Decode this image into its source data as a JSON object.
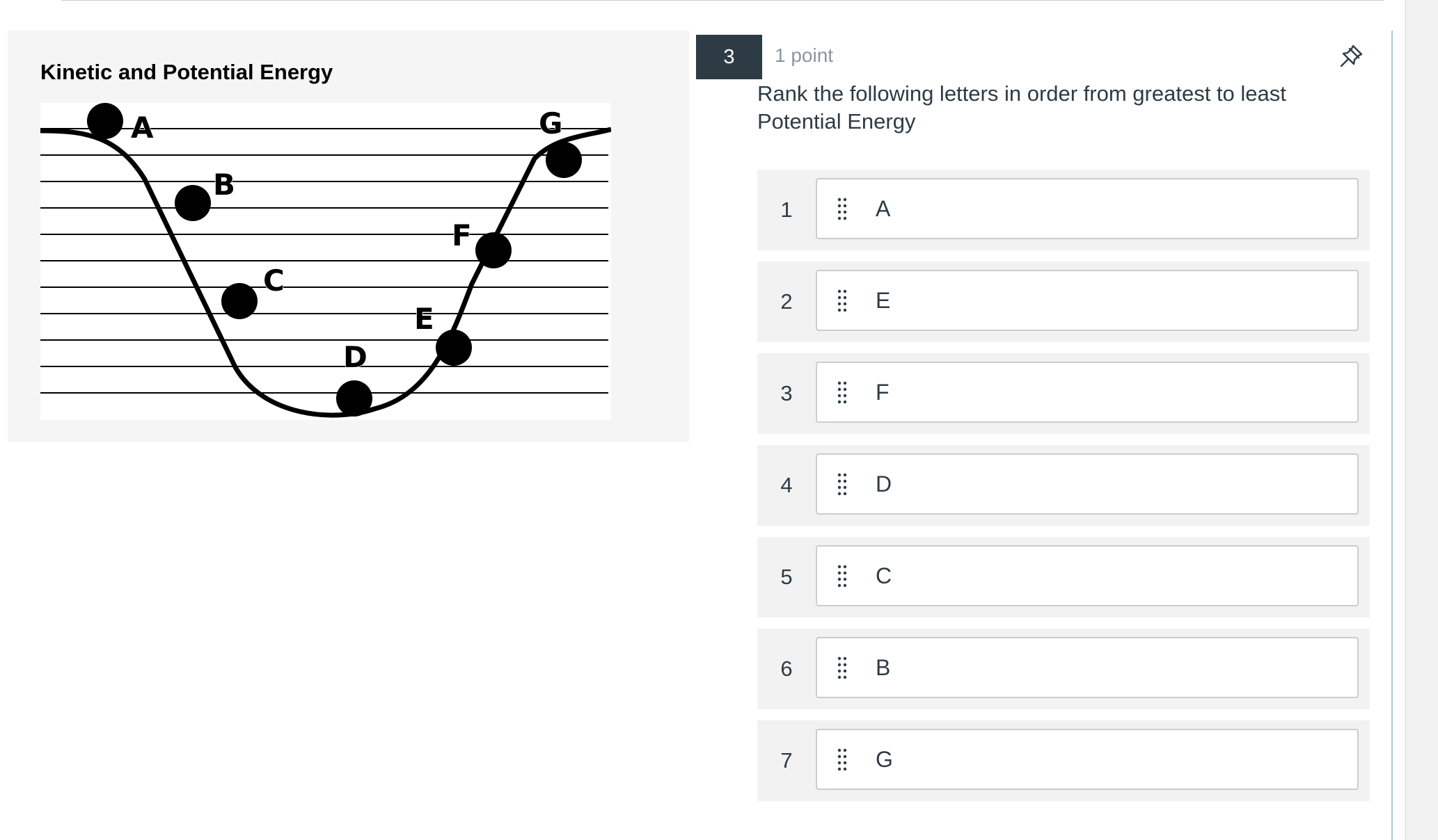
{
  "stimulus": {
    "title": "Kinetic and Potential Energy",
    "figure_labels": {
      "a": "A",
      "b": "B",
      "c": "C",
      "d": "D",
      "e": "E",
      "f": "F",
      "g": "G"
    }
  },
  "question": {
    "number": "3",
    "points": "1 point",
    "prompt": "Rank the following letters in order from greatest to least Potential Energy",
    "ranking": [
      {
        "position": "1",
        "label": "A"
      },
      {
        "position": "2",
        "label": "E"
      },
      {
        "position": "3",
        "label": "F"
      },
      {
        "position": "4",
        "label": "D"
      },
      {
        "position": "5",
        "label": "C"
      },
      {
        "position": "6",
        "label": "B"
      },
      {
        "position": "7",
        "label": "G"
      }
    ]
  },
  "icons": {
    "pin": "pin-icon",
    "drag": "drag-handle-icon"
  },
  "colors": {
    "question_number_bg": "#2d3b45",
    "text": "#2d3b45",
    "muted_text": "#8b969e",
    "card_border": "#c7cdd1",
    "row_bg": "#f2f2f2",
    "focus_border": "#a9c6e8"
  }
}
